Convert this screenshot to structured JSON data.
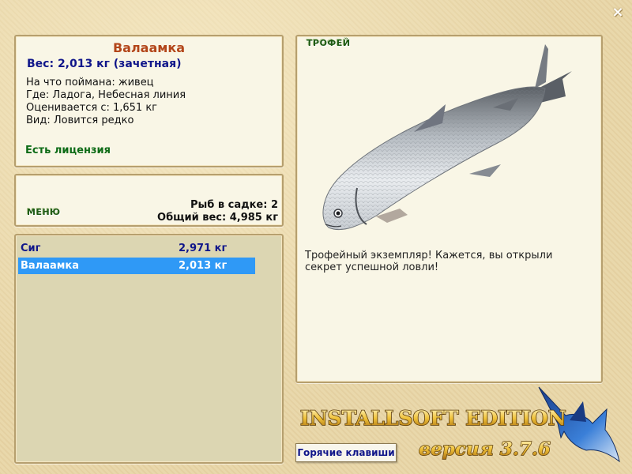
{
  "window": {
    "close_label": "×"
  },
  "fish_info": {
    "name": "Валаамка",
    "weight": "Вес: 2,013 кг (зачетная)",
    "details": [
      "На что поймана: живец",
      "Где: Ладога, Небесная линия",
      "Оценивается с: 1,651 кг",
      "Вид: Ловится редко"
    ],
    "license": "Есть лицензия"
  },
  "menu": {
    "label": "МЕНЮ",
    "fish_count": "Рыб в садке: 2",
    "total_weight": "Общий вес: 4,985 кг"
  },
  "catch_list": [
    {
      "name": "Сиг",
      "weight": "2,971 кг",
      "selected": false
    },
    {
      "name": "Валаамка",
      "weight": "2,013 кг",
      "selected": true
    }
  ],
  "trophy": {
    "label": "ТРОФЕЙ",
    "description": "Трофейный экземпляр! Кажется, вы открыли секрет успешной ловли!"
  },
  "branding": {
    "edition": "INSTALLSOFT EDITION",
    "version": "версия 3.7.6"
  },
  "hotkeys": {
    "label": "Горячие клавиши"
  },
  "colors": {
    "accent_name": "#b3461a",
    "weight_blue": "#10168a",
    "license_green": "#0d6b16",
    "selection": "#2f99f6"
  }
}
